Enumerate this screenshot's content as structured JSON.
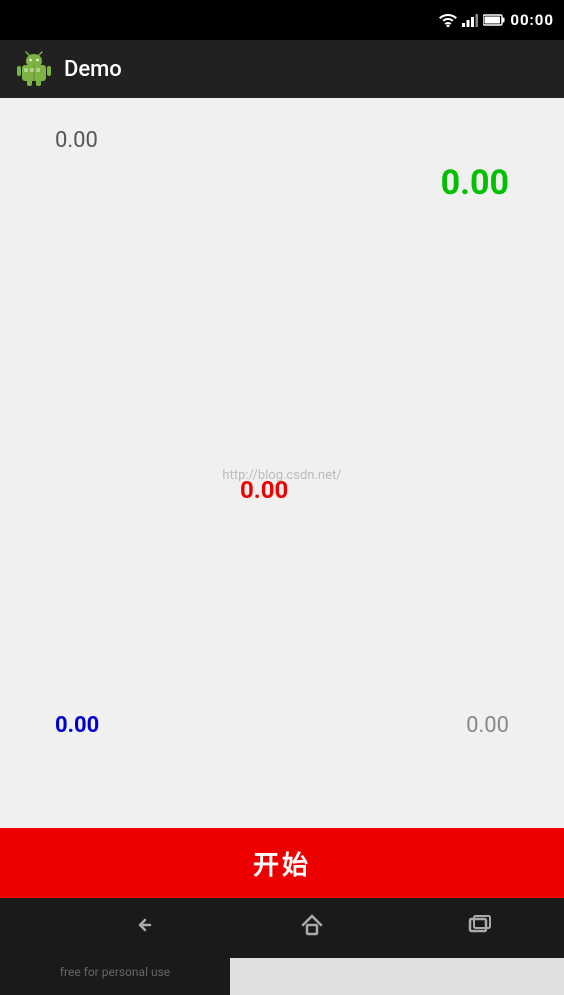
{
  "statusBar": {
    "time": "00:00"
  },
  "actionBar": {
    "title": "Demo"
  },
  "mainContent": {
    "valueTopLeft": "0.00",
    "valueTopRight": "0.00",
    "watermark": "http://blog.csdn.net/",
    "valueCenter": "0.00",
    "valueBottomLeft": "0.00",
    "valueBottomRight": "0.00"
  },
  "startButton": {
    "label": "开始"
  },
  "navBar": {
    "backIcon": "←",
    "homeIcon": "⌂",
    "recentsIcon": "▭"
  },
  "bottomWatermark": {
    "text": "free for personal use"
  }
}
